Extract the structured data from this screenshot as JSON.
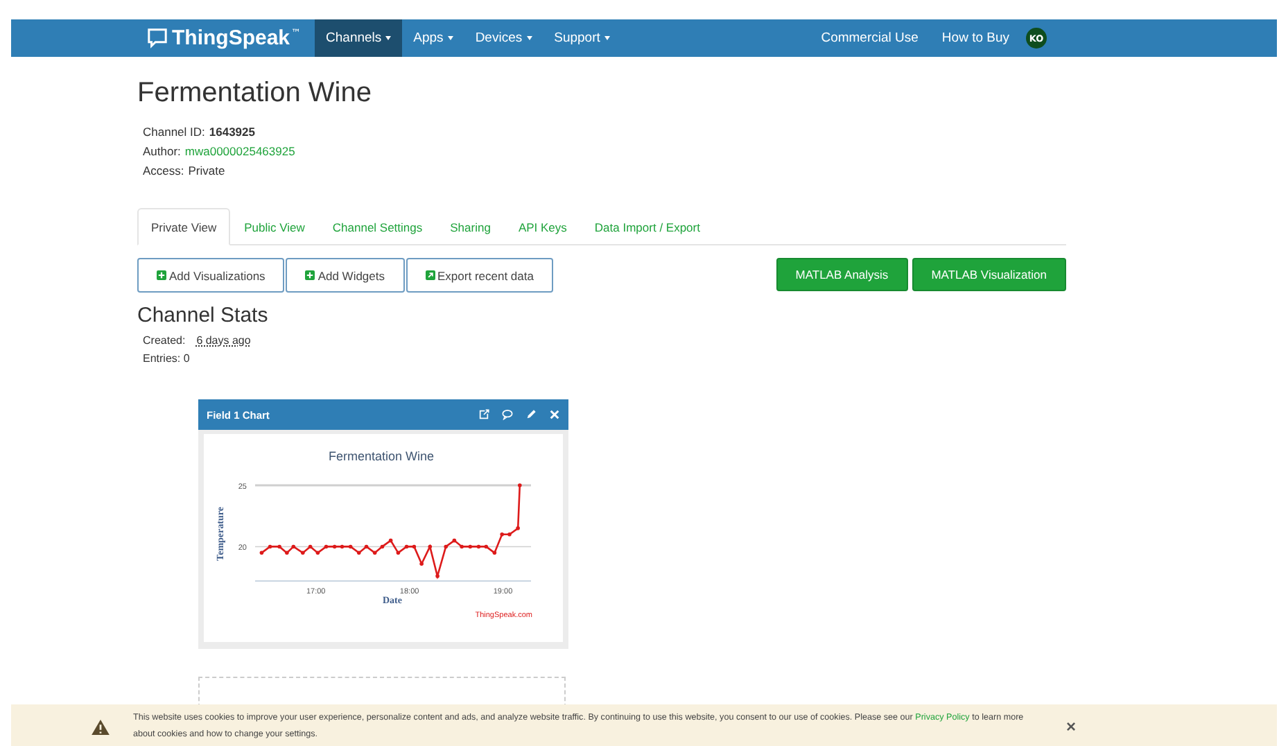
{
  "navbar": {
    "logo": "ThingSpeak",
    "trademark": "™",
    "menus": [
      {
        "label": "Channels",
        "selected": true
      },
      {
        "label": "Apps",
        "selected": false
      },
      {
        "label": "Devices",
        "selected": false
      },
      {
        "label": "Support",
        "selected": false
      }
    ],
    "links": [
      "Commercial Use",
      "How to Buy"
    ],
    "avatar": "KO"
  },
  "channel": {
    "title": "Fermentation Wine",
    "meta": [
      {
        "label": "Channel ID:",
        "value": "1643925",
        "kind": "bold"
      },
      {
        "label": "Author:",
        "value": "mwa0000025463925",
        "kind": "link"
      },
      {
        "label": "Access:",
        "value": "Private",
        "kind": "plain"
      }
    ]
  },
  "tabs": [
    {
      "label": "Private View",
      "selected": true
    },
    {
      "label": "Public View",
      "selected": false
    },
    {
      "label": "Channel Settings",
      "selected": false
    },
    {
      "label": "Sharing",
      "selected": false
    },
    {
      "label": "API Keys",
      "selected": false
    },
    {
      "label": "Data Import / Export",
      "selected": false
    }
  ],
  "actions": [
    {
      "label": "Add Visualizations",
      "kind": "plus"
    },
    {
      "label": "Add Widgets",
      "kind": "plus"
    },
    {
      "label": "Export recent data",
      "kind": "export"
    }
  ],
  "matlab_buttons": [
    "MATLAB Analysis",
    "MATLAB Visualization"
  ],
  "stats": {
    "title": "Channel Stats",
    "created_label": "Created:",
    "created_value": "6 days ago",
    "entries": "Entries: 0"
  },
  "widget": {
    "title": "Field 1 Chart",
    "credit": "ThingSpeak.com",
    "chart_data": {
      "type": "line",
      "title": "Fermentation Wine",
      "xlabel": "Date",
      "ylabel": "Temperature",
      "xlim": [
        16.35,
        19.3
      ],
      "ylim": [
        17.2,
        25
      ],
      "xticks": [
        {
          "value": 17,
          "label": "17:00"
        },
        {
          "value": 18,
          "label": "18:00"
        },
        {
          "value": 19,
          "label": "19:00"
        }
      ],
      "yticks": [
        20,
        25
      ],
      "x": [
        16.42,
        16.51,
        16.61,
        16.69,
        16.76,
        16.86,
        16.94,
        17.02,
        17.11,
        17.2,
        17.28,
        17.37,
        17.46,
        17.54,
        17.63,
        17.71,
        17.8,
        17.88,
        17.97,
        18.05,
        18.13,
        18.22,
        18.3,
        18.39,
        18.48,
        18.56,
        18.65,
        18.74,
        18.82,
        18.91,
        18.99,
        19.07,
        19.16,
        19.18
      ],
      "series": [
        {
          "color": "#dd1b1b",
          "values": [
            19.5,
            20,
            20,
            19.5,
            20,
            19.5,
            20,
            19.5,
            20,
            20,
            20,
            20,
            19.5,
            20,
            19.5,
            20,
            20.5,
            19.5,
            20,
            20,
            18.6,
            20,
            17.6,
            20,
            20.5,
            20,
            20,
            20,
            20,
            19.5,
            21,
            21,
            21.5,
            25
          ]
        }
      ]
    }
  },
  "cookie": {
    "text": "This website uses cookies to improve your user experience, personalize content and ads, and analyze website traffic. By continuing to use this website, you consent to our use of cookies. Please see our",
    "link": "Privacy Policy",
    "after": "to learn more about cookies and how to change your settings.",
    "close": "×"
  }
}
